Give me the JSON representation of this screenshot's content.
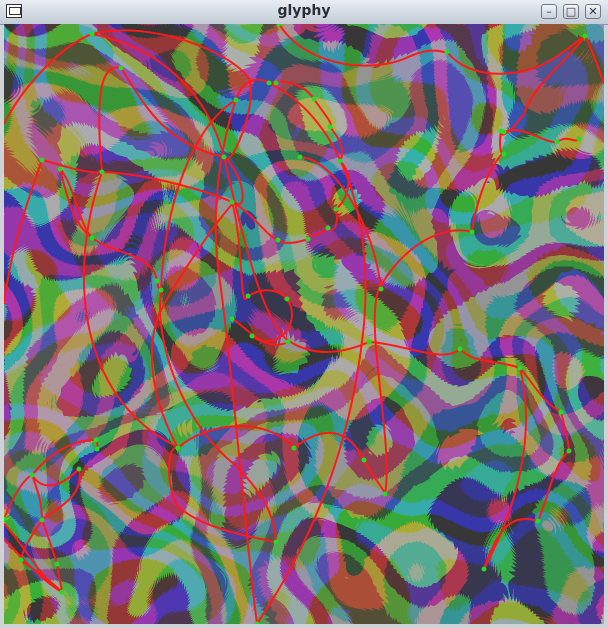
{
  "window": {
    "title": "glyphy",
    "icons": [
      "app-icon",
      "minimize-icon",
      "maximize-icon",
      "close-icon"
    ],
    "glyphs": {
      "minimize": "–",
      "maximize": "□",
      "close": "✕"
    }
  },
  "colors": {
    "outline": "#ff1a1a",
    "control_point": "#22dd22",
    "field_dark": "#0b0b0b",
    "field_light": "#9a9a9a"
  }
}
